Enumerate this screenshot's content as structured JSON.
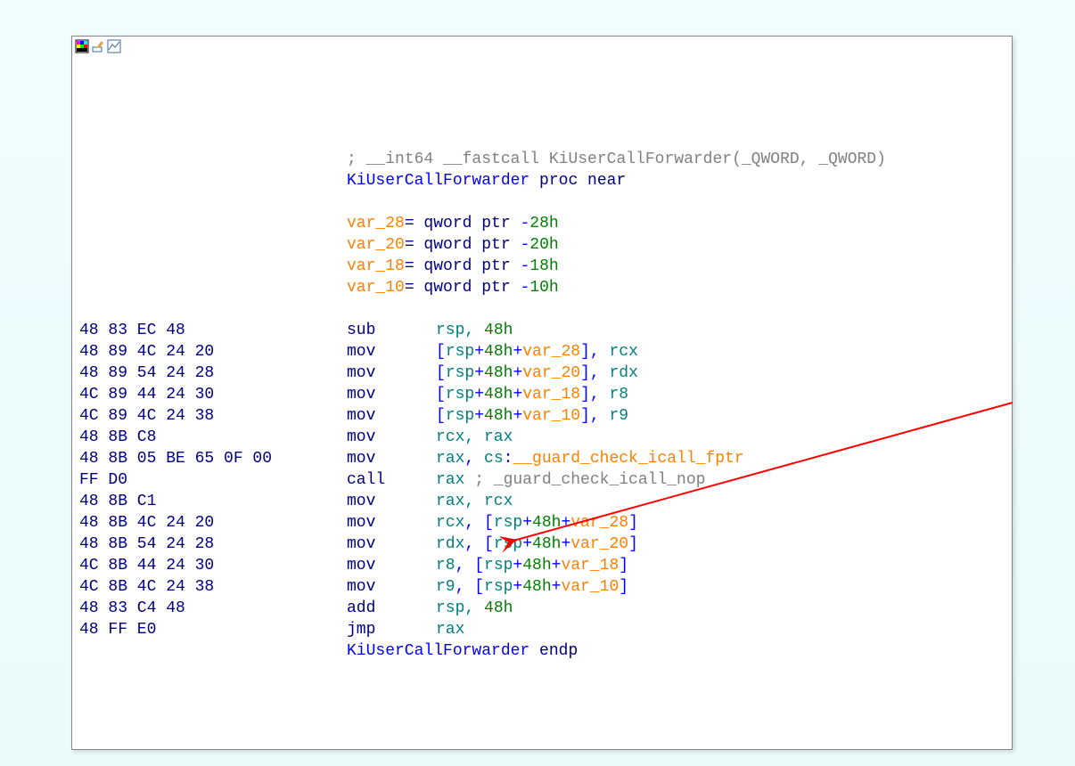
{
  "toolbar": {
    "icon1": "color-picker-icon",
    "icon2": "edit-icon",
    "icon3": "graph-icon"
  },
  "blank_top_lines": 4,
  "header": {
    "comment_prefix": "; ",
    "comment_text": "__int64 __fastcall KiUserCallForwarder(_QWORD, _QWORD)",
    "proc_name": "KiUserCallForwarder",
    "proc_keyword": "proc near"
  },
  "vars": [
    {
      "name": "var_28",
      "decl": "qword ptr -28h"
    },
    {
      "name": "var_20",
      "decl": "qword ptr -20h"
    },
    {
      "name": "var_18",
      "decl": "qword ptr -18h"
    },
    {
      "name": "var_10",
      "decl": "qword ptr -10h"
    }
  ],
  "lines": [
    {
      "bytes": "48 83 EC 48",
      "mnem": "sub",
      "ops": [
        {
          "t": "rsp, ",
          "k": "teal"
        },
        {
          "t": "48h",
          "k": "green"
        }
      ]
    },
    {
      "bytes": "48 89 4C 24 20",
      "mnem": "mov",
      "ops": [
        {
          "t": "[",
          "k": "blue"
        },
        {
          "t": "rsp",
          "k": "teal"
        },
        {
          "t": "+",
          "k": "blue"
        },
        {
          "t": "48h",
          "k": "green"
        },
        {
          "t": "+",
          "k": "blue"
        },
        {
          "t": "var_28",
          "k": "orange"
        },
        {
          "t": "], ",
          "k": "blue"
        },
        {
          "t": "rcx",
          "k": "teal"
        }
      ]
    },
    {
      "bytes": "48 89 54 24 28",
      "mnem": "mov",
      "ops": [
        {
          "t": "[",
          "k": "blue"
        },
        {
          "t": "rsp",
          "k": "teal"
        },
        {
          "t": "+",
          "k": "blue"
        },
        {
          "t": "48h",
          "k": "green"
        },
        {
          "t": "+",
          "k": "blue"
        },
        {
          "t": "var_20",
          "k": "orange"
        },
        {
          "t": "], ",
          "k": "blue"
        },
        {
          "t": "rdx",
          "k": "teal"
        }
      ]
    },
    {
      "bytes": "4C 89 44 24 30",
      "mnem": "mov",
      "ops": [
        {
          "t": "[",
          "k": "blue"
        },
        {
          "t": "rsp",
          "k": "teal"
        },
        {
          "t": "+",
          "k": "blue"
        },
        {
          "t": "48h",
          "k": "green"
        },
        {
          "t": "+",
          "k": "blue"
        },
        {
          "t": "var_18",
          "k": "orange"
        },
        {
          "t": "], ",
          "k": "blue"
        },
        {
          "t": "r8",
          "k": "teal"
        }
      ]
    },
    {
      "bytes": "4C 89 4C 24 38",
      "mnem": "mov",
      "ops": [
        {
          "t": "[",
          "k": "blue"
        },
        {
          "t": "rsp",
          "k": "teal"
        },
        {
          "t": "+",
          "k": "blue"
        },
        {
          "t": "48h",
          "k": "green"
        },
        {
          "t": "+",
          "k": "blue"
        },
        {
          "t": "var_10",
          "k": "orange"
        },
        {
          "t": "], ",
          "k": "blue"
        },
        {
          "t": "r9",
          "k": "teal"
        }
      ]
    },
    {
      "bytes": "48 8B C8",
      "mnem": "mov",
      "ops": [
        {
          "t": "rcx, rax",
          "k": "teal"
        }
      ]
    },
    {
      "bytes": "48 8B 05 BE 65 0F 00",
      "mnem": "mov",
      "ops": [
        {
          "t": "rax",
          "k": "teal"
        },
        {
          "t": ", ",
          "k": "blue"
        },
        {
          "t": "cs",
          "k": "teal"
        },
        {
          "t": ":",
          "k": "blue"
        },
        {
          "t": "__guard_check_icall_fptr",
          "k": "orange"
        }
      ]
    },
    {
      "bytes": "FF D0",
      "mnem": "call",
      "ops": [
        {
          "t": "rax ",
          "k": "teal"
        },
        {
          "t": "; _guard_check_icall_nop",
          "k": "gray"
        }
      ]
    },
    {
      "bytes": "48 8B C1",
      "mnem": "mov",
      "ops": [
        {
          "t": "rax, rcx",
          "k": "teal"
        }
      ]
    },
    {
      "bytes": "48 8B 4C 24 20",
      "mnem": "mov",
      "ops": [
        {
          "t": "rcx",
          "k": "teal"
        },
        {
          "t": ", [",
          "k": "blue"
        },
        {
          "t": "rsp",
          "k": "teal"
        },
        {
          "t": "+",
          "k": "blue"
        },
        {
          "t": "48h",
          "k": "green"
        },
        {
          "t": "+",
          "k": "blue"
        },
        {
          "t": "var_28",
          "k": "orange"
        },
        {
          "t": "]",
          "k": "blue"
        }
      ]
    },
    {
      "bytes": "48 8B 54 24 28",
      "mnem": "mov",
      "ops": [
        {
          "t": "rdx",
          "k": "teal"
        },
        {
          "t": ", [",
          "k": "blue"
        },
        {
          "t": "rsp",
          "k": "teal"
        },
        {
          "t": "+",
          "k": "blue"
        },
        {
          "t": "48h",
          "k": "green"
        },
        {
          "t": "+",
          "k": "blue"
        },
        {
          "t": "var_20",
          "k": "orange"
        },
        {
          "t": "]",
          "k": "blue"
        }
      ]
    },
    {
      "bytes": "4C 8B 44 24 30",
      "mnem": "mov",
      "ops": [
        {
          "t": "r8",
          "k": "teal"
        },
        {
          "t": ", [",
          "k": "blue"
        },
        {
          "t": "rsp",
          "k": "teal"
        },
        {
          "t": "+",
          "k": "blue"
        },
        {
          "t": "48h",
          "k": "green"
        },
        {
          "t": "+",
          "k": "blue"
        },
        {
          "t": "var_18",
          "k": "orange"
        },
        {
          "t": "]",
          "k": "blue"
        }
      ]
    },
    {
      "bytes": "4C 8B 4C 24 38",
      "mnem": "mov",
      "ops": [
        {
          "t": "r9",
          "k": "teal"
        },
        {
          "t": ", [",
          "k": "blue"
        },
        {
          "t": "rsp",
          "k": "teal"
        },
        {
          "t": "+",
          "k": "blue"
        },
        {
          "t": "48h",
          "k": "green"
        },
        {
          "t": "+",
          "k": "blue"
        },
        {
          "t": "var_10",
          "k": "orange"
        },
        {
          "t": "]",
          "k": "blue"
        }
      ]
    },
    {
      "bytes": "48 83 C4 48",
      "mnem": "add",
      "ops": [
        {
          "t": "rsp, ",
          "k": "teal"
        },
        {
          "t": "48h",
          "k": "green"
        }
      ]
    },
    {
      "bytes": "48 FF E0",
      "mnem": "jmp",
      "ops": [
        {
          "t": "rax",
          "k": "teal"
        }
      ]
    }
  ],
  "footer": {
    "proc_name": "KiUserCallForwarder",
    "endp": "endp"
  }
}
